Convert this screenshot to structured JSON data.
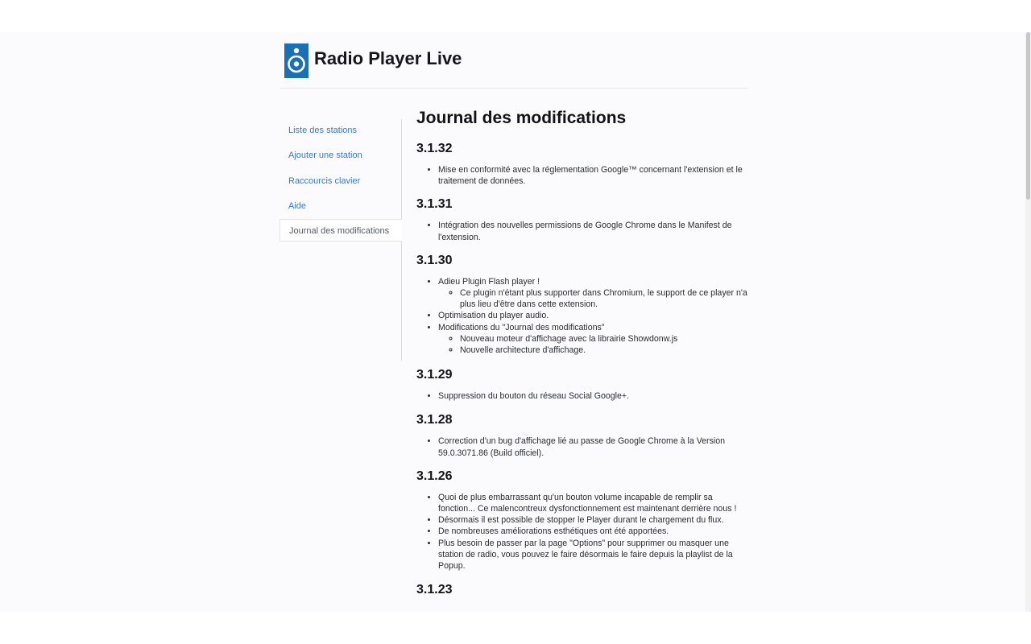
{
  "app": {
    "title": "Radio Player Live"
  },
  "sidebar": {
    "items": [
      {
        "label": "Liste des stations"
      },
      {
        "label": "Ajouter une station"
      },
      {
        "label": "Raccourcis clavier"
      },
      {
        "label": "Aide"
      },
      {
        "label": "Journal des modifications",
        "active": true
      }
    ]
  },
  "main": {
    "title": "Journal des modifications",
    "versions": [
      {
        "version": "3.1.32",
        "items": [
          {
            "text": "Mise en conformité avec la réglementation Google™ concernant l'extension et le traitement de données."
          }
        ]
      },
      {
        "version": "3.1.31",
        "items": [
          {
            "text": "Intégration des nouvelles permissions de Google Chrome dans le Manifest de l'extension."
          }
        ]
      },
      {
        "version": "3.1.30",
        "items": [
          {
            "text": "Adieu Plugin Flash player !",
            "sub": [
              "Ce plugin n'étant plus supporter dans Chromium, le support de ce player n'a plus lieu d'être dans cette extension."
            ]
          },
          {
            "text": "Optimisation du player audio."
          },
          {
            "text": "Modifications du \"Journal des modifications\"",
            "sub": [
              "Nouveau moteur d'affichage avec la librairie Showdonw.js",
              "Nouvelle architecture d'affichage."
            ]
          }
        ]
      },
      {
        "version": "3.1.29",
        "items": [
          {
            "text": "Suppression du bouton du réseau Social Google+."
          }
        ]
      },
      {
        "version": "3.1.28",
        "items": [
          {
            "text": "Correction d'un bug d'affichage lié au passe de Google Chrome à la Version 59.0.3071.86 (Build officiel)."
          }
        ]
      },
      {
        "version": "3.1.26",
        "items": [
          {
            "text": "Quoi de plus embarrassant qu'un bouton volume incapable de remplir sa fonction... Ce malencontreux dysfonctionnement est maintenant derrière nous !"
          },
          {
            "text": "Désormais il est possible de stopper le Player durant le chargement du flux."
          },
          {
            "text": "De nombreuses améliorations esthétiques ont été apportées."
          },
          {
            "text": "Plus besoin de passer par la page \"Options\" pour supprimer ou masquer une station de radio, vous pouvez le faire désormais le faire depuis la playlist de la Popup."
          }
        ]
      },
      {
        "version": "3.1.23",
        "items": []
      }
    ]
  },
  "colors": {
    "link": "#3c78c6",
    "logo": "#1d6fb5",
    "page_bg": "#fbfbfd"
  },
  "icons": {
    "logo": "speaker-icon"
  }
}
